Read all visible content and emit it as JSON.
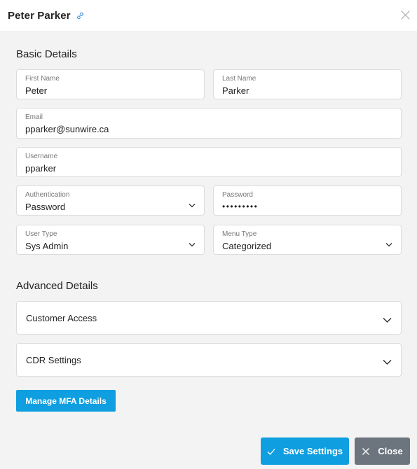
{
  "header": {
    "title": "Peter Parker",
    "link_icon": "link-icon",
    "close_icon": "close-icon"
  },
  "basic": {
    "title": "Basic Details",
    "first_name": {
      "label": "First Name",
      "value": "Peter"
    },
    "last_name": {
      "label": "Last Name",
      "value": "Parker"
    },
    "email": {
      "label": "Email",
      "value": "pparker@sunwire.ca"
    },
    "username": {
      "label": "Username",
      "value": "pparker"
    },
    "authentication": {
      "label": "Authentication",
      "value": "Password"
    },
    "password": {
      "label": "Password",
      "value": "•••••••••"
    },
    "user_type": {
      "label": "User Type",
      "value": "Sys Admin"
    },
    "menu_type": {
      "label": "Menu Type",
      "value": "Categorized"
    }
  },
  "advanced": {
    "title": "Advanced Details",
    "sections": [
      {
        "label": "Customer Access"
      },
      {
        "label": "CDR Settings"
      }
    ]
  },
  "buttons": {
    "mfa": "Manage MFA Details",
    "save": "Save Settings",
    "close": "Close"
  },
  "colors": {
    "primary": "#0f9fe0",
    "secondary": "#6c757d",
    "background": "#f3f3f3"
  }
}
